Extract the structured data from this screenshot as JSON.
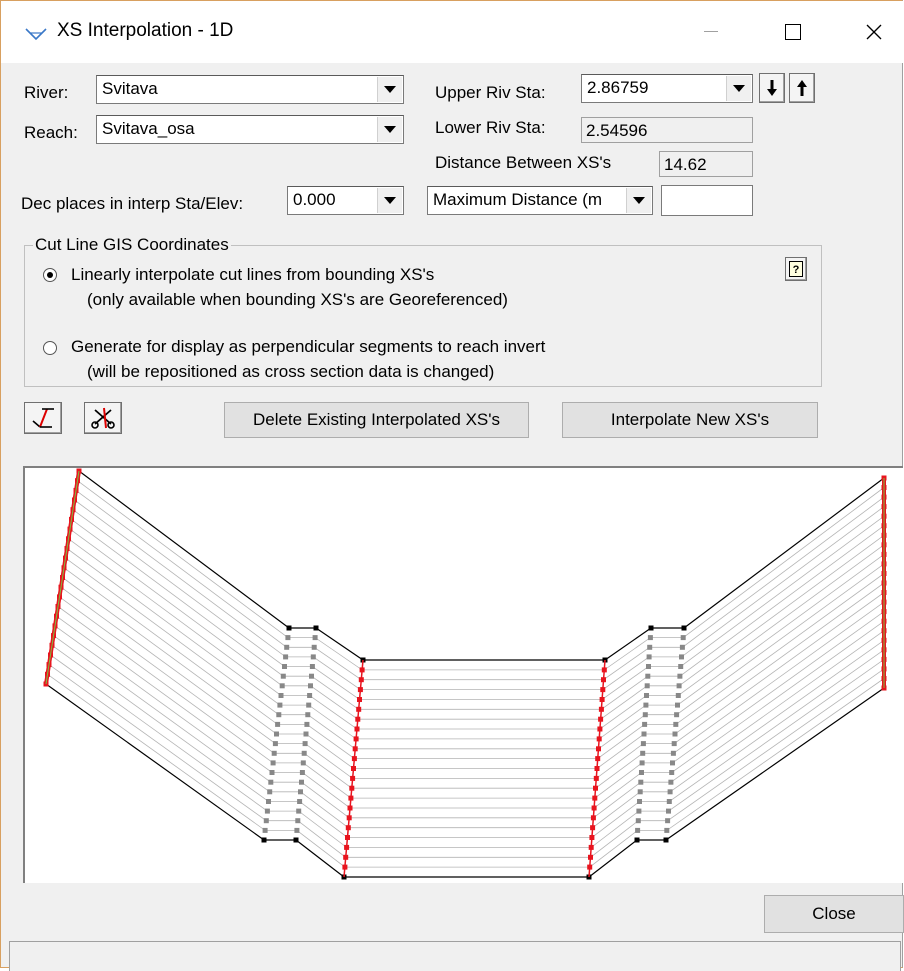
{
  "window": {
    "title": "XS Interpolation  - 1D"
  },
  "form": {
    "river_label": "River:",
    "river_value": "Svitava",
    "reach_label": "Reach:",
    "reach_value": "Svitava_osa",
    "upper_label": "Upper Riv Sta:",
    "upper_value": "2.86759",
    "lower_label": "Lower Riv Sta:",
    "lower_value": "2.54596",
    "distance_label": "Distance Between XS's",
    "distance_value": "14.62",
    "dec_label": "Dec places in interp Sta/Elev:",
    "dec_value": "0.000",
    "maxdist_value": "Maximum Distance (m",
    "maxdist_input": ""
  },
  "group": {
    "title": "Cut Line GIS Coordinates",
    "option1_line1": "Linearly interpolate cut lines from bounding XS's",
    "option1_line2": "(only available when bounding XS's are Georeferenced)",
    "option2_line1": "Generate for display as perpendicular segments to reach invert",
    "option2_line2": "(will be repositioned as cross section data is changed)",
    "selected_option": 1
  },
  "toolbar": {
    "delete_label": "Delete Existing Interpolated XS's",
    "interpolate_label": "Interpolate New XS's"
  },
  "footer": {
    "close_label": "Close",
    "status_text": ""
  },
  "colors": {
    "bounding_xs": "#e8141e",
    "interp_xs": "#b4b4b4",
    "fixed_points": "#000000",
    "highlight": "#7ac142"
  },
  "icons": {
    "title": "river-icon",
    "down": "down-arrow-icon",
    "up": "up-arrow-icon",
    "help": "help-icon",
    "draw": "draw-line-icon",
    "delete": "scissors-icon"
  }
}
